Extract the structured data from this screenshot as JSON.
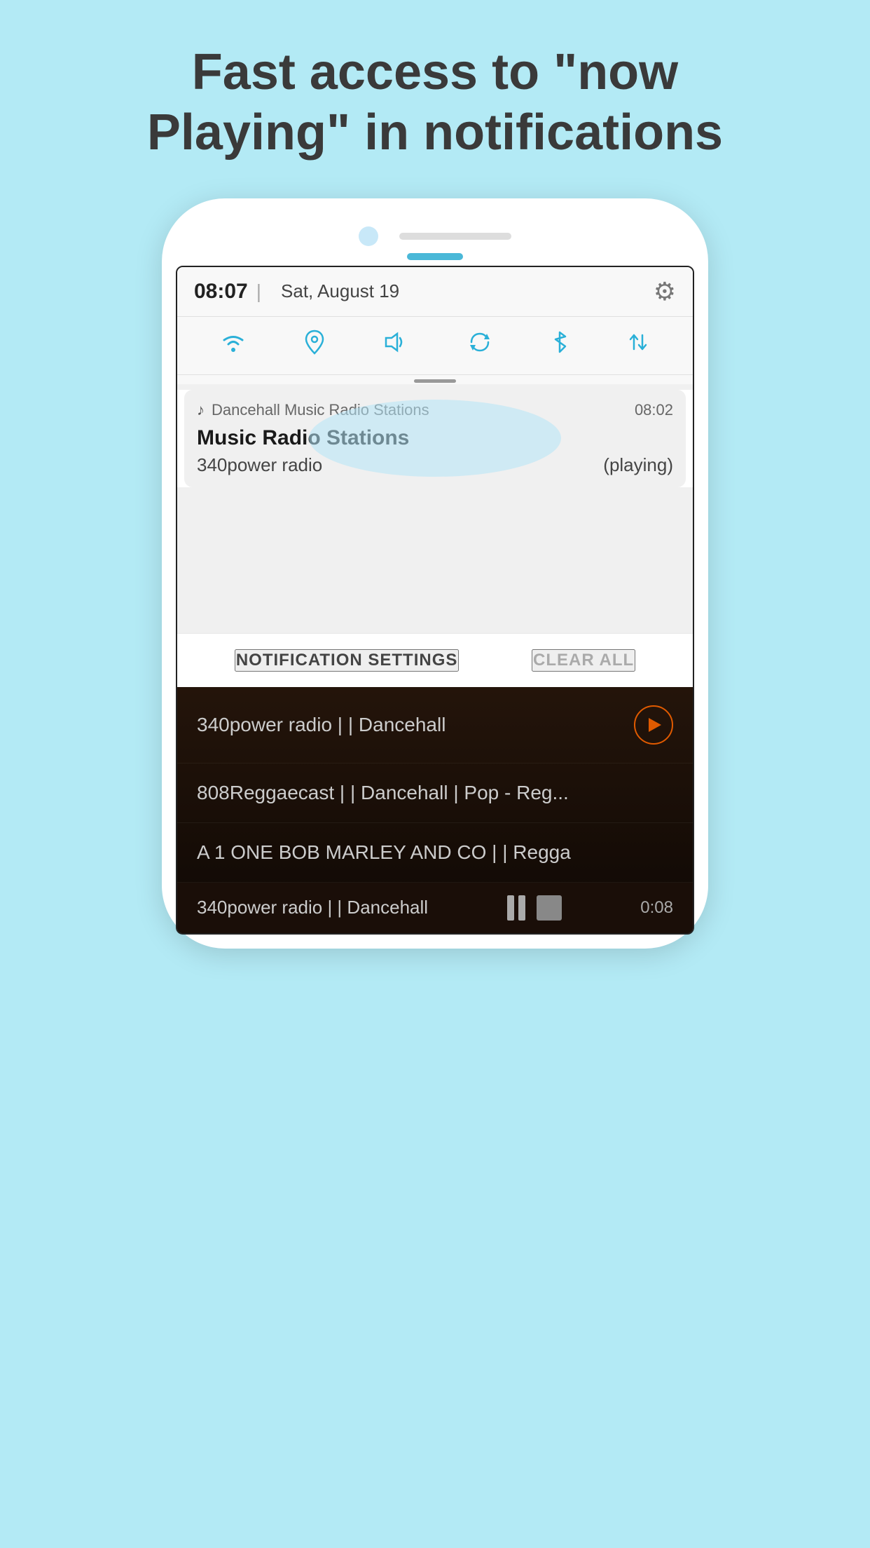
{
  "page": {
    "title_line1": "Fast access to \"now",
    "title_line2": "Playing\" in notifications",
    "background_color": "#b3eaf5"
  },
  "status_bar": {
    "time": "08:07",
    "separator": "|",
    "date": "Sat, August 19"
  },
  "quick_settings": {
    "icons": [
      "wifi",
      "location",
      "volume",
      "sync",
      "bluetooth",
      "sort"
    ]
  },
  "notification": {
    "app_name": "Dancehall Music Radio Stations",
    "time": "08:02",
    "title": "Music Radio Stations",
    "station": "340power radio",
    "status": "(playing)"
  },
  "bottom_bar": {
    "settings_label": "NOTIFICATION SETTINGS",
    "clear_label": "CLEAR ALL"
  },
  "radio_list": {
    "items": [
      {
        "label": "340power radio | | Dancehall",
        "has_play_icon": true
      },
      {
        "label": "808Reggaecast | | Dancehall | Pop - Reg...",
        "has_play_icon": false
      },
      {
        "label": "A 1 ONE BOB MARLEY AND CO | | Regga",
        "has_play_icon": false
      }
    ]
  },
  "player_bar": {
    "station": "340power radio | | Dancehall",
    "time": "0:08"
  }
}
